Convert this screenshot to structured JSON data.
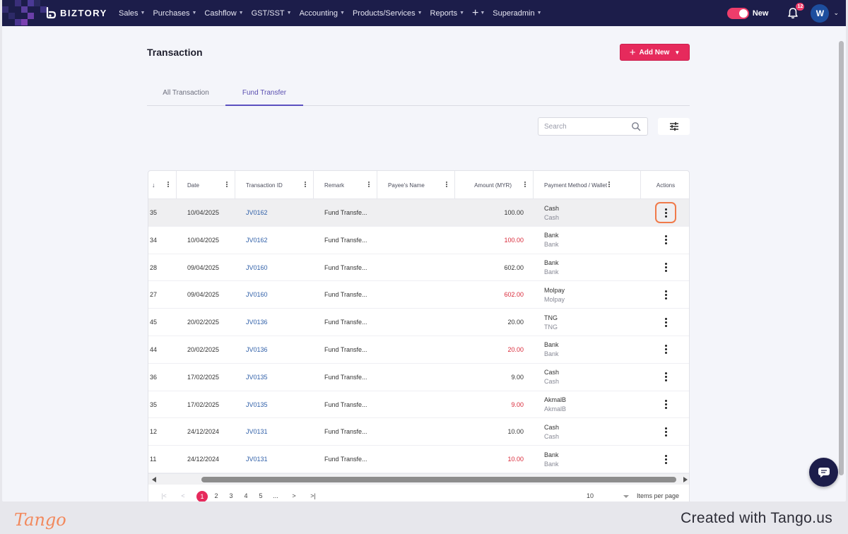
{
  "app": {
    "brand": "BIZTORY",
    "menu": [
      "Sales",
      "Purchases",
      "Cashflow",
      "GST/SST",
      "Accounting",
      "Products/Services",
      "Reports",
      "Superadmin"
    ],
    "plus_label": "+",
    "toggle_label": "New",
    "notification_count": "12",
    "avatar_initial": "W"
  },
  "page": {
    "title": "Transaction",
    "add_button": "Add New",
    "tabs": [
      "All Transaction",
      "Fund Transfer"
    ],
    "active_tab": "Fund Transfer",
    "search_placeholder": "Search"
  },
  "table": {
    "headers": {
      "date": "Date",
      "transaction_id": "Transaction ID",
      "remark": "Remark",
      "payee": "Payee's Name",
      "amount": "Amount (MYR)",
      "method": "Payment Method / Wallet",
      "actions": "Actions"
    },
    "rows": [
      {
        "no": "35",
        "date": "10/04/2025",
        "txid": "JV0162",
        "remark": "Fund Transfe...",
        "payee": "",
        "amount": "100.00",
        "negative": false,
        "method": "Cash",
        "wallet": "Cash"
      },
      {
        "no": "34",
        "date": "10/04/2025",
        "txid": "JV0162",
        "remark": "Fund Transfe...",
        "payee": "",
        "amount": "100.00",
        "negative": true,
        "method": "Bank",
        "wallet": "Bank"
      },
      {
        "no": "28",
        "date": "09/04/2025",
        "txid": "JV0160",
        "remark": "Fund Transfe...",
        "payee": "",
        "amount": "602.00",
        "negative": false,
        "method": "Bank",
        "wallet": "Bank"
      },
      {
        "no": "27",
        "date": "09/04/2025",
        "txid": "JV0160",
        "remark": "Fund Transfe...",
        "payee": "",
        "amount": "602.00",
        "negative": true,
        "method": "Molpay",
        "wallet": "Molpay"
      },
      {
        "no": "45",
        "date": "20/02/2025",
        "txid": "JV0136",
        "remark": "Fund Transfe...",
        "payee": "",
        "amount": "20.00",
        "negative": false,
        "method": "TNG",
        "wallet": "TNG"
      },
      {
        "no": "44",
        "date": "20/02/2025",
        "txid": "JV0136",
        "remark": "Fund Transfe...",
        "payee": "",
        "amount": "20.00",
        "negative": true,
        "method": "Bank",
        "wallet": "Bank"
      },
      {
        "no": "36",
        "date": "17/02/2025",
        "txid": "JV0135",
        "remark": "Fund Transfe...",
        "payee": "",
        "amount": "9.00",
        "negative": false,
        "method": "Cash",
        "wallet": "Cash"
      },
      {
        "no": "35",
        "date": "17/02/2025",
        "txid": "JV0135",
        "remark": "Fund Transfe...",
        "payee": "",
        "amount": "9.00",
        "negative": true,
        "method": "AkmalB",
        "wallet": "AkmalB"
      },
      {
        "no": "12",
        "date": "24/12/2024",
        "txid": "JV0131",
        "remark": "Fund Transfe...",
        "payee": "",
        "amount": "10.00",
        "negative": false,
        "method": "Cash",
        "wallet": "Cash"
      },
      {
        "no": "11",
        "date": "24/12/2024",
        "txid": "JV0131",
        "remark": "Fund Transfe...",
        "payee": "",
        "amount": "10.00",
        "negative": true,
        "method": "Bank",
        "wallet": "Bank"
      }
    ],
    "selected_row": 0
  },
  "pagination": {
    "first": "|<",
    "prev": "<",
    "pages": [
      "1",
      "2",
      "3",
      "4",
      "5"
    ],
    "ellipsis": "...",
    "next": ">",
    "last": ">|",
    "current": "1",
    "per_page": "10",
    "per_page_label": "Items per page"
  },
  "footer": {
    "tango_logo": "Tango",
    "created_with": "Created with Tango.us"
  },
  "colors": {
    "nav_bg": "#1c1d4a",
    "accent": "#e62a5c",
    "link": "#2f5fa8",
    "negative": "#d92a3a",
    "highlight": "#f07a4a"
  }
}
